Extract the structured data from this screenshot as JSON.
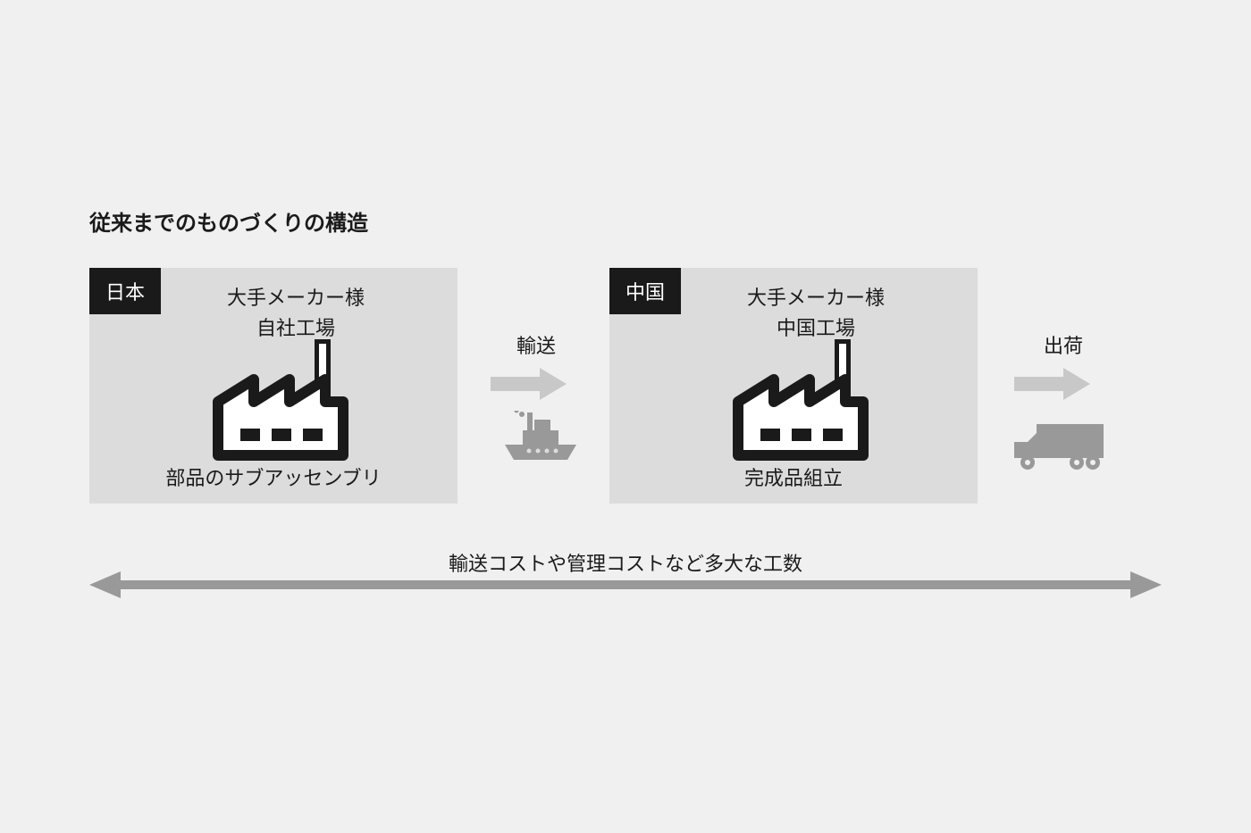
{
  "title": "従来までのものづくりの構造",
  "japan": {
    "tag": "日本",
    "line1": "大手メーカー様",
    "line2": "自社工場",
    "line3": "部品のサブアッセンブリ"
  },
  "china": {
    "tag": "中国",
    "line1": "大手メーカー様",
    "line2": "中国工場",
    "line3": "完成品組立"
  },
  "transport1": "輸送",
  "transport2": "出荷",
  "bottomLabel": "輸送コストや管理コストなど多大な工数"
}
